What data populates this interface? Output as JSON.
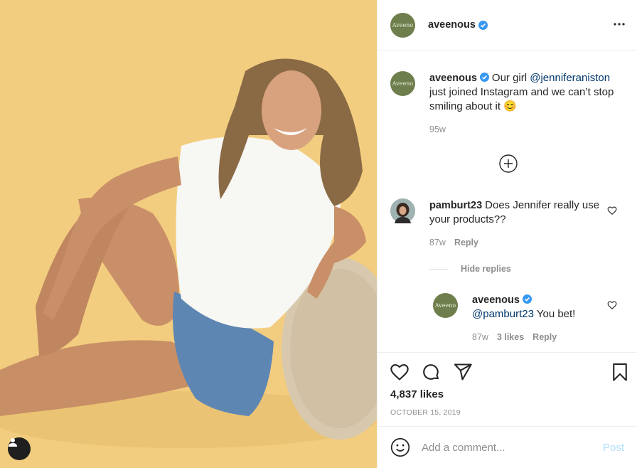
{
  "post": {
    "author": "aveenous",
    "avatar_text": "Aveeno",
    "accent_color": "#3897f0",
    "media_background": "#f3cd7f"
  },
  "header": {
    "username": "aveenous",
    "more_icon": "more-horizontal-icon"
  },
  "caption": {
    "username": "aveenous",
    "text_before": "Our girl ",
    "mention": "@jenniferaniston",
    "text_after": " just joined Instagram and we can’t stop smiling about it 😊",
    "age": "95w"
  },
  "comments": [
    {
      "username": "pamburt23",
      "text": "Does Jennifer really use your products??",
      "age": "87w",
      "reply_label": "Reply",
      "hide_replies_label": "Hide replies"
    }
  ],
  "reply": {
    "username": "aveenous",
    "mention": "@pamburt23",
    "text": " You bet!",
    "age": "87w",
    "likes_label": "3 likes",
    "reply_label": "Reply"
  },
  "actions": {
    "likes": "4,837 likes",
    "date": "OCTOBER 15, 2019"
  },
  "composer": {
    "placeholder": "Add a comment...",
    "post_label": "Post"
  }
}
